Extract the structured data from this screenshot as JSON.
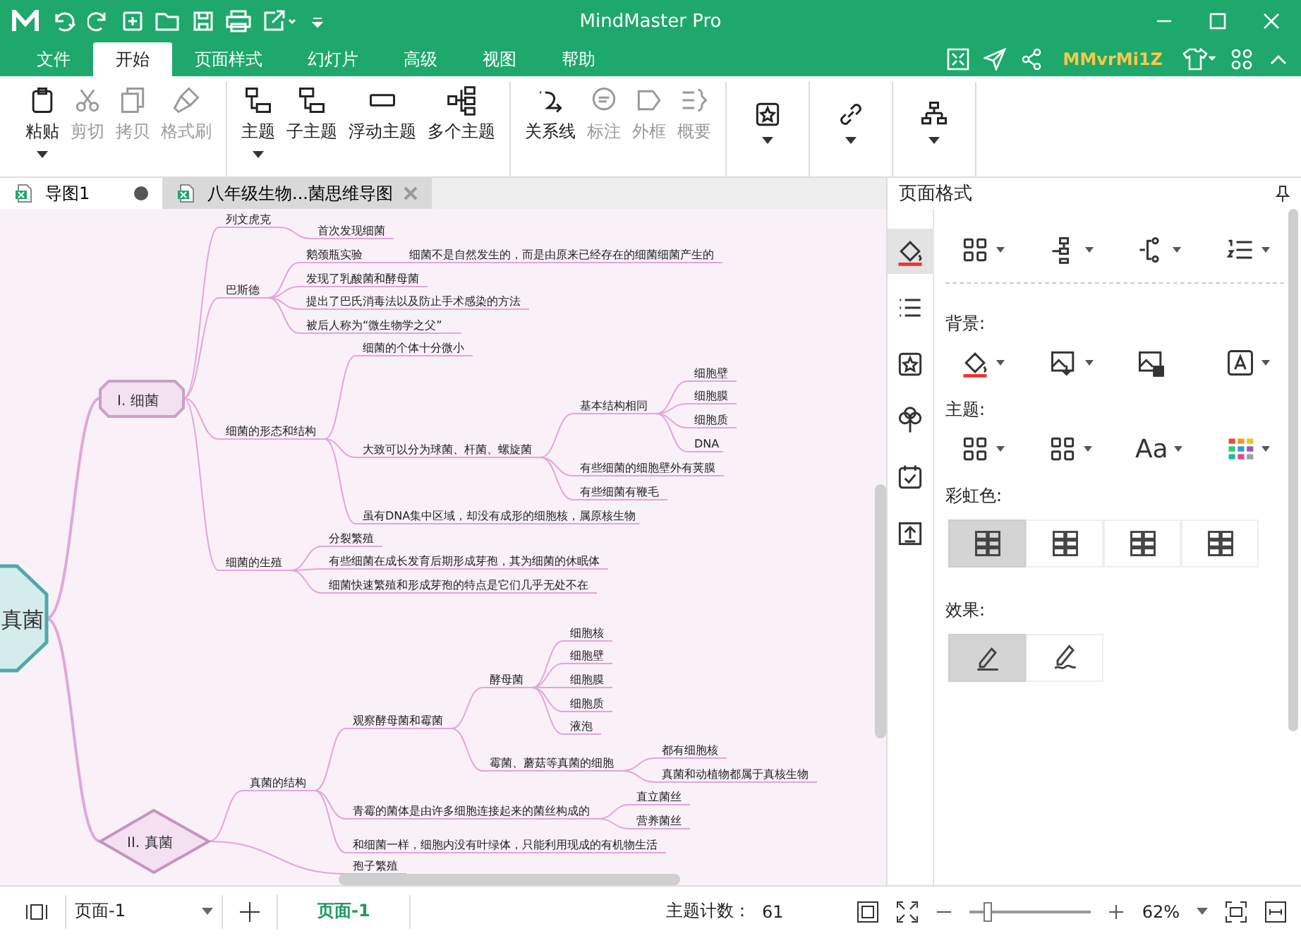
{
  "window": {
    "title": "MindMaster Pro"
  },
  "menu_tabs": [
    {
      "label": "文件",
      "selected": false
    },
    {
      "label": "开始",
      "selected": true
    },
    {
      "label": "页面样式",
      "selected": false
    },
    {
      "label": "幻灯片",
      "selected": false
    },
    {
      "label": "高级",
      "selected": false
    },
    {
      "label": "视图",
      "selected": false
    },
    {
      "label": "帮助",
      "selected": false
    }
  ],
  "account": {
    "username": "MMvrMi1Z"
  },
  "ribbon": {
    "groups": [
      [
        {
          "label": "粘贴",
          "kind": "clipboard",
          "disabled": false,
          "dropdown": true
        },
        {
          "label": "剪切",
          "kind": "scissors",
          "disabled": true,
          "dropdown": false
        },
        {
          "label": "拷贝",
          "kind": "copy",
          "disabled": true,
          "dropdown": false
        },
        {
          "label": "格式刷",
          "kind": "brush",
          "disabled": true,
          "dropdown": false
        }
      ],
      [
        {
          "label": "主题",
          "kind": "topic",
          "disabled": false,
          "dropdown": true
        },
        {
          "label": "子主题",
          "kind": "subtopic",
          "disabled": false,
          "dropdown": false
        },
        {
          "label": "浮动主题",
          "kind": "float",
          "disabled": false,
          "dropdown": false
        },
        {
          "label": "多个主题",
          "kind": "multi",
          "disabled": false,
          "dropdown": false
        }
      ],
      [
        {
          "label": "关系线",
          "kind": "relation",
          "disabled": false,
          "dropdown": false
        },
        {
          "label": "标注",
          "kind": "callout",
          "disabled": true,
          "dropdown": false
        },
        {
          "label": "外框",
          "kind": "boundary",
          "disabled": true,
          "dropdown": false
        },
        {
          "label": "概要",
          "kind": "summary",
          "disabled": true,
          "dropdown": false
        }
      ]
    ]
  },
  "doc_tabs": [
    {
      "label": "导图1",
      "selected": false,
      "modified": true
    },
    {
      "label": "八年级生物...菌思维导图",
      "selected": true,
      "modified": false
    }
  ],
  "mind_map": {
    "root": {
      "text": "真菌",
      "kind": "root",
      "children": [
        {
          "text": "I. 细菌",
          "kind": "octagon",
          "children": [
            {
              "text": "列文虎克",
              "children": [
                {
                  "text": "首次发现细菌"
                }
              ]
            },
            {
              "text": "巴斯德",
              "children": [
                {
                  "text": "鹅颈瓶实验",
                  "children": [
                    {
                      "text": "细菌不是自然发生的，而是由原来已经存在的细菌细菌产生的"
                    }
                  ]
                },
                {
                  "text": "发现了乳酸菌和酵母菌"
                },
                {
                  "text": "提出了巴氏消毒法以及防止手术感染的方法"
                },
                {
                  "text": "被后人称为“微生物学之父”"
                }
              ]
            },
            {
              "text": "细菌的形态和结构",
              "children": [
                {
                  "text": "细菌的个体十分微小"
                },
                {
                  "text": "大致可以分为球菌、杆菌、螺旋菌",
                  "children": [
                    {
                      "text": "基本结构相同",
                      "children": [
                        {
                          "text": "细胞壁"
                        },
                        {
                          "text": "细胞膜"
                        },
                        {
                          "text": "细胞质"
                        },
                        {
                          "text": "DNA"
                        }
                      ]
                    },
                    {
                      "text": "有些细菌的细胞壁外有荚膜"
                    },
                    {
                      "text": "有些细菌有鞭毛"
                    }
                  ]
                },
                {
                  "text": "虽有DNA集中区域，却没有成形的细胞核，属原核生物"
                }
              ]
            },
            {
              "text": "细菌的生殖",
              "children": [
                {
                  "text": "分裂繁殖"
                },
                {
                  "text": "有些细菌在成长发育后期形成芽孢，其为细菌的休眠体"
                },
                {
                  "text": "细菌快速繁殖和形成芽孢的特点是它们几乎无处不在"
                }
              ]
            }
          ]
        },
        {
          "text": "II. 真菌",
          "kind": "diamond",
          "children": [
            {
              "text": "真菌的结构",
              "children": [
                {
                  "text": "观察酵母菌和霉菌",
                  "children": [
                    {
                      "text": "酵母菌",
                      "children": [
                        {
                          "text": "细胞核"
                        },
                        {
                          "text": "细胞壁"
                        },
                        {
                          "text": "细胞膜"
                        },
                        {
                          "text": "细胞质"
                        },
                        {
                          "text": "液泡"
                        }
                      ]
                    },
                    {
                      "text": "霉菌、蘑菇等真菌的细胞",
                      "children": [
                        {
                          "text": "都有细胞核"
                        },
                        {
                          "text": "真菌和动植物都属于真核生物"
                        }
                      ]
                    }
                  ]
                },
                {
                  "text": "青霉的菌体是由许多细胞连接起来的菌丝构成的",
                  "children": [
                    {
                      "text": "直立菌丝"
                    },
                    {
                      "text": "营养菌丝"
                    }
                  ]
                },
                {
                  "text": "和细菌一样，细胞内没有叶绿体，只能利用现成的有机物生活"
                }
              ]
            },
            {
              "text": "孢子繁殖"
            }
          ]
        }
      ]
    }
  },
  "panel": {
    "title": "页面格式",
    "side_tabs": [
      {
        "kind": "brush",
        "selected": true
      },
      {
        "kind": "list",
        "selected": false
      },
      {
        "kind": "clipart",
        "selected": false
      },
      {
        "kind": "clover",
        "selected": false
      },
      {
        "kind": "calendar",
        "selected": false
      },
      {
        "kind": "export",
        "selected": false
      }
    ],
    "background_label": "背景:",
    "theme_label": "主题:",
    "font_button": "Aa",
    "rainbow_label": "彩虹色:",
    "rainbow_options": [
      {
        "selected": true
      },
      {
        "selected": false
      },
      {
        "selected": false
      },
      {
        "selected": false
      }
    ],
    "effect_label": "效果:",
    "effect_options": [
      {
        "selected": true
      },
      {
        "selected": false
      }
    ]
  },
  "status_bar": {
    "page_select": "页面-1",
    "page_tab": "页面-1",
    "topic_count_label": "主题计数：",
    "topic_count": "61",
    "zoom": {
      "level": 0.15,
      "reading": "62%"
    }
  }
}
